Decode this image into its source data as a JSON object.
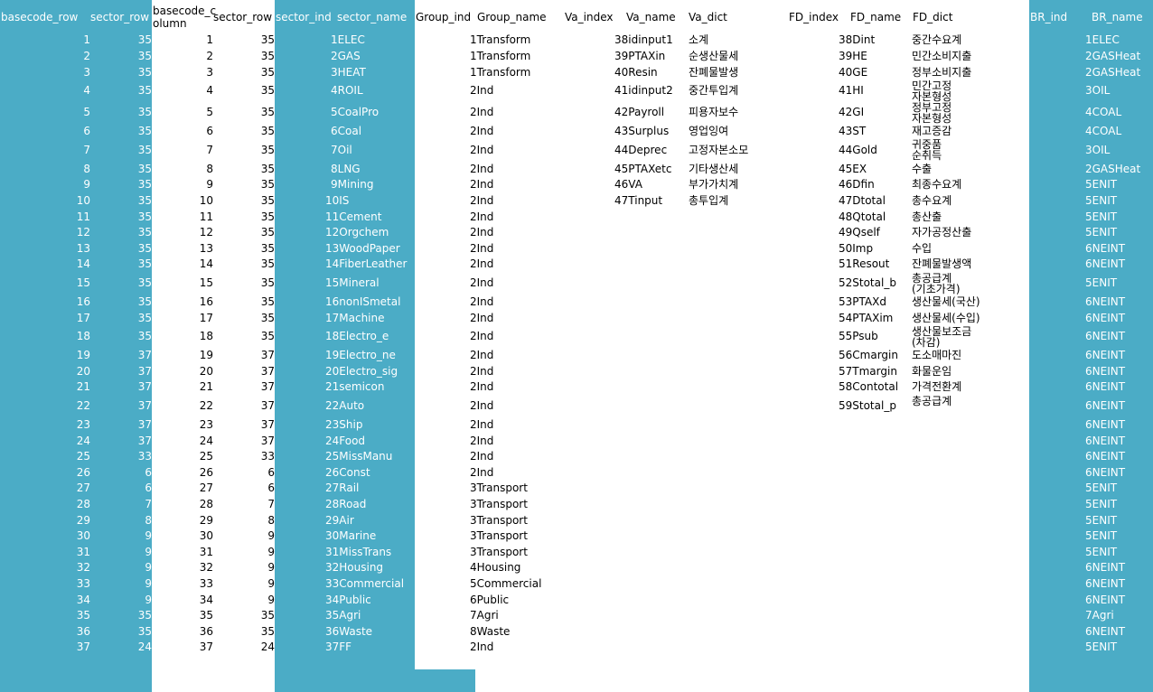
{
  "colors": {
    "band": "#4bacc6",
    "text_on_band": "#ffffff",
    "text": "#000000",
    "background": "#ffffff"
  },
  "headers": {
    "basecode_row": "basecode_row",
    "sector_row": "sector_row",
    "basecode_column_1": "basecode_c",
    "basecode_column_2": "olumn",
    "sector_row2": "sector_row",
    "sector_ind": "sector_ind",
    "sector_name": "sector_name",
    "group_ind": "Group_ind",
    "group_name": "Group_name",
    "va_index": "Va_index",
    "va_name": "Va_name",
    "va_dict": "Va_dict",
    "fd_index": "FD_index",
    "fd_name": "FD_name",
    "fd_dict": "FD_dict",
    "br_ind": "BR_ind",
    "br_name": "BR_name"
  },
  "rows": [
    {
      "bcr": "1",
      "sr": "35",
      "bcc": "1",
      "sr2": "35",
      "sname": "1ELEC",
      "gname": "1Transform",
      "vname": "38idinput1",
      "vdict": "소계",
      "fname": "38Dint",
      "fdict": "중간수요계",
      "brname": "1ELEC"
    },
    {
      "bcr": "2",
      "sr": "35",
      "bcc": "2",
      "sr2": "35",
      "sname": "2GAS",
      "gname": "1Transform",
      "vname": "39PTAXin",
      "vdict": "순생산물세",
      "fname": "39HE",
      "fdict": "민간소비지출",
      "brname": "2GASHeat"
    },
    {
      "bcr": "3",
      "sr": "35",
      "bcc": "3",
      "sr2": "35",
      "sname": "3HEAT",
      "gname": "1Transform",
      "vname": "40Resin",
      "vdict": "잔폐물발생",
      "fname": "40GE",
      "fdict": "정부소비지출",
      "brname": "2GASHeat"
    },
    {
      "bcr": "4",
      "sr": "35",
      "bcc": "4",
      "sr2": "35",
      "sname": "4ROIL",
      "gname": "2Ind",
      "vname": "41idinput2",
      "vdict": "중간투입계",
      "fname": "41HI",
      "fdict": "민간고정",
      "fdict2": "자본형성",
      "brname": "3OIL"
    },
    {
      "bcr": "5",
      "sr": "35",
      "bcc": "5",
      "sr2": "35",
      "sname": "5CoalPro",
      "gname": "2Ind",
      "vname": "42Payroll",
      "vdict": "피용자보수",
      "fname": "42GI",
      "fdict": "정부고정",
      "fdict2": "자본형성",
      "brname": "4COAL"
    },
    {
      "bcr": "6",
      "sr": "35",
      "bcc": "6",
      "sr2": "35",
      "sname": "6Coal",
      "gname": "2Ind",
      "vname": "43Surplus",
      "vdict": "영업잉여",
      "fname": "43ST",
      "fdict": "재고증감",
      "brname": "4COAL"
    },
    {
      "bcr": "7",
      "sr": "35",
      "bcc": "7",
      "sr2": "35",
      "sname": "7Oil",
      "gname": "2Ind",
      "vname": "44Deprec",
      "vdict": "고정자본소모",
      "fname": "44Gold",
      "fdict": "귀중품",
      "fdict2": "순취득",
      "brname": "3OIL"
    },
    {
      "bcr": "8",
      "sr": "35",
      "bcc": "8",
      "sr2": "35",
      "sname": "8LNG",
      "gname": "2Ind",
      "vname": "45PTAXetc",
      "vdict": "기타생산세",
      "fname": "45EX",
      "fdict": "수출",
      "brname": "2GASHeat"
    },
    {
      "bcr": "9",
      "sr": "35",
      "bcc": "9",
      "sr2": "35",
      "sname": "9Mining",
      "gname": "2Ind",
      "vname": "46VA",
      "vdict": "부가가치계",
      "fname": "46Dfin",
      "fdict": "최종수요계",
      "brname": "5ENIT"
    },
    {
      "bcr": "10",
      "sr": "35",
      "bcc": "10",
      "sr2": "35",
      "sname": "10IS",
      "gname": "2Ind",
      "vname": "47Tinput",
      "vdict": "총투입계",
      "fname": "47Dtotal",
      "fdict": "총수요계",
      "brname": "5ENIT"
    },
    {
      "bcr": "11",
      "sr": "35",
      "bcc": "11",
      "sr2": "35",
      "sname": "11Cement",
      "gname": "2Ind",
      "vname": "",
      "vdict": "",
      "fname": "48Qtotal",
      "fdict": "총산출",
      "brname": "5ENIT"
    },
    {
      "bcr": "12",
      "sr": "35",
      "bcc": "12",
      "sr2": "35",
      "sname": "12Orgchem",
      "gname": "2Ind",
      "vname": "",
      "vdict": "",
      "fname": "49Qself",
      "fdict": "자가공정산출",
      "brname": "5ENIT"
    },
    {
      "bcr": "13",
      "sr": "35",
      "bcc": "13",
      "sr2": "35",
      "sname": "13WoodPaper",
      "gname": "2Ind",
      "vname": "",
      "vdict": "",
      "fname": "50Imp",
      "fdict": "수입",
      "brname": "6NEINT"
    },
    {
      "bcr": "14",
      "sr": "35",
      "bcc": "14",
      "sr2": "35",
      "sname": "14FiberLeather",
      "gname": "2Ind",
      "vname": "",
      "vdict": "",
      "fname": "51Resout",
      "fdict": "잔폐물발생액",
      "brname": "6NEINT"
    },
    {
      "bcr": "15",
      "sr": "35",
      "bcc": "15",
      "sr2": "35",
      "sname": "15Mineral",
      "gname": "2Ind",
      "vname": "",
      "vdict": "",
      "fname": "52Stotal_b",
      "fdict": "총공급계",
      "fdict2": "(기초가격)",
      "brname": "5ENIT"
    },
    {
      "bcr": "16",
      "sr": "35",
      "bcc": "16",
      "sr2": "35",
      "sname": "16nonISmetal",
      "gname": "2Ind",
      "vname": "",
      "vdict": "",
      "fname": "53PTAXd",
      "fdict": "생산물세(국산)",
      "brname": "6NEINT"
    },
    {
      "bcr": "17",
      "sr": "35",
      "bcc": "17",
      "sr2": "35",
      "sname": "17Machine",
      "gname": "2Ind",
      "vname": "",
      "vdict": "",
      "fname": "54PTAXim",
      "fdict": "생산물세(수입)",
      "brname": "6NEINT"
    },
    {
      "bcr": "18",
      "sr": "35",
      "bcc": "18",
      "sr2": "35",
      "sname": "18Electro_e",
      "gname": "2Ind",
      "vname": "",
      "vdict": "",
      "fname": "55Psub",
      "fdict": "생산물보조금",
      "fdict2": "(차감)",
      "brname": "6NEINT"
    },
    {
      "bcr": "19",
      "sr": "37",
      "bcc": "19",
      "sr2": "37",
      "sname": "19Electro_ne",
      "gname": "2Ind",
      "vname": "",
      "vdict": "",
      "fname": "56Cmargin",
      "fdict": "도소매마진",
      "brname": "6NEINT"
    },
    {
      "bcr": "20",
      "sr": "37",
      "bcc": "20",
      "sr2": "37",
      "sname": "20Electro_sig",
      "gname": "2Ind",
      "vname": "",
      "vdict": "",
      "fname": "57Tmargin",
      "fdict": "화물운임",
      "brname": "6NEINT"
    },
    {
      "bcr": "21",
      "sr": "37",
      "bcc": "21",
      "sr2": "37",
      "sname": "21semicon",
      "gname": "2Ind",
      "vname": "",
      "vdict": "",
      "fname": "58Contotal",
      "fdict": "가격전환계",
      "brname": "6NEINT"
    },
    {
      "bcr": "22",
      "sr": "37",
      "bcc": "22",
      "sr2": "37",
      "sname": "22Auto",
      "gname": "2Ind",
      "vname": "",
      "vdict": "",
      "fname": "59Stotal_p",
      "fdict": "총공급계",
      "brname": "6NEINT"
    },
    {
      "bcr": "23",
      "sr": "37",
      "bcc": "23",
      "sr2": "37",
      "sname": "23Ship",
      "gname": "2Ind",
      "vname": "",
      "vdict": "",
      "fname": "",
      "fdict": "",
      "brname": "6NEINT"
    },
    {
      "bcr": "24",
      "sr": "37",
      "bcc": "24",
      "sr2": "37",
      "sname": "24Food",
      "gname": "2Ind",
      "vname": "",
      "vdict": "",
      "fname": "",
      "fdict": "",
      "brname": "6NEINT"
    },
    {
      "bcr": "25",
      "sr": "33",
      "bcc": "25",
      "sr2": "33",
      "sname": "25MissManu",
      "gname": "2Ind",
      "vname": "",
      "vdict": "",
      "fname": "",
      "fdict": "",
      "brname": "6NEINT"
    },
    {
      "bcr": "26",
      "sr": "6",
      "bcc": "26",
      "sr2": "6",
      "sname": "26Const",
      "gname": "2Ind",
      "vname": "",
      "vdict": "",
      "fname": "",
      "fdict": "",
      "brname": "6NEINT"
    },
    {
      "bcr": "27",
      "sr": "6",
      "bcc": "27",
      "sr2": "6",
      "sname": "27Rail",
      "gname": "3Transport",
      "vname": "",
      "vdict": "",
      "fname": "",
      "fdict": "",
      "brname": "5ENIT"
    },
    {
      "bcr": "28",
      "sr": "7",
      "bcc": "28",
      "sr2": "7",
      "sname": "28Road",
      "gname": "3Transport",
      "vname": "",
      "vdict": "",
      "fname": "",
      "fdict": "",
      "brname": "5ENIT"
    },
    {
      "bcr": "29",
      "sr": "8",
      "bcc": "29",
      "sr2": "8",
      "sname": "29Air",
      "gname": "3Transport",
      "vname": "",
      "vdict": "",
      "fname": "",
      "fdict": "",
      "brname": "5ENIT"
    },
    {
      "bcr": "30",
      "sr": "9",
      "bcc": "30",
      "sr2": "9",
      "sname": "30Marine",
      "gname": "3Transport",
      "vname": "",
      "vdict": "",
      "fname": "",
      "fdict": "",
      "brname": "5ENIT"
    },
    {
      "bcr": "31",
      "sr": "9",
      "bcc": "31",
      "sr2": "9",
      "sname": "31MissTrans",
      "gname": "3Transport",
      "vname": "",
      "vdict": "",
      "fname": "",
      "fdict": "",
      "brname": "5ENIT"
    },
    {
      "bcr": "32",
      "sr": "9",
      "bcc": "32",
      "sr2": "9",
      "sname": "32Housing",
      "gname": "4Housing",
      "vname": "",
      "vdict": "",
      "fname": "",
      "fdict": "",
      "brname": "6NEINT"
    },
    {
      "bcr": "33",
      "sr": "9",
      "bcc": "33",
      "sr2": "9",
      "sname": "33Commercial",
      "gname": "5Commercial",
      "vname": "",
      "vdict": "",
      "fname": "",
      "fdict": "",
      "brname": "6NEINT"
    },
    {
      "bcr": "34",
      "sr": "9",
      "bcc": "34",
      "sr2": "9",
      "sname": "34Public",
      "gname": "6Public",
      "vname": "",
      "vdict": "",
      "fname": "",
      "fdict": "",
      "brname": "6NEINT"
    },
    {
      "bcr": "35",
      "sr": "35",
      "bcc": "35",
      "sr2": "35",
      "sname": "35Agri",
      "gname": "7Agri",
      "vname": "",
      "vdict": "",
      "fname": "",
      "fdict": "",
      "brname": "7Agri"
    },
    {
      "bcr": "36",
      "sr": "35",
      "bcc": "36",
      "sr2": "35",
      "sname": "36Waste",
      "gname": "8Waste",
      "vname": "",
      "vdict": "",
      "fname": "",
      "fdict": "",
      "brname": "6NEINT"
    },
    {
      "bcr": "37",
      "sr": "24",
      "bcc": "37",
      "sr2": "24",
      "sname": "37FF",
      "gname": "2Ind",
      "vname": "",
      "vdict": "",
      "fname": "",
      "fdict": "",
      "brname": "5ENIT"
    }
  ]
}
